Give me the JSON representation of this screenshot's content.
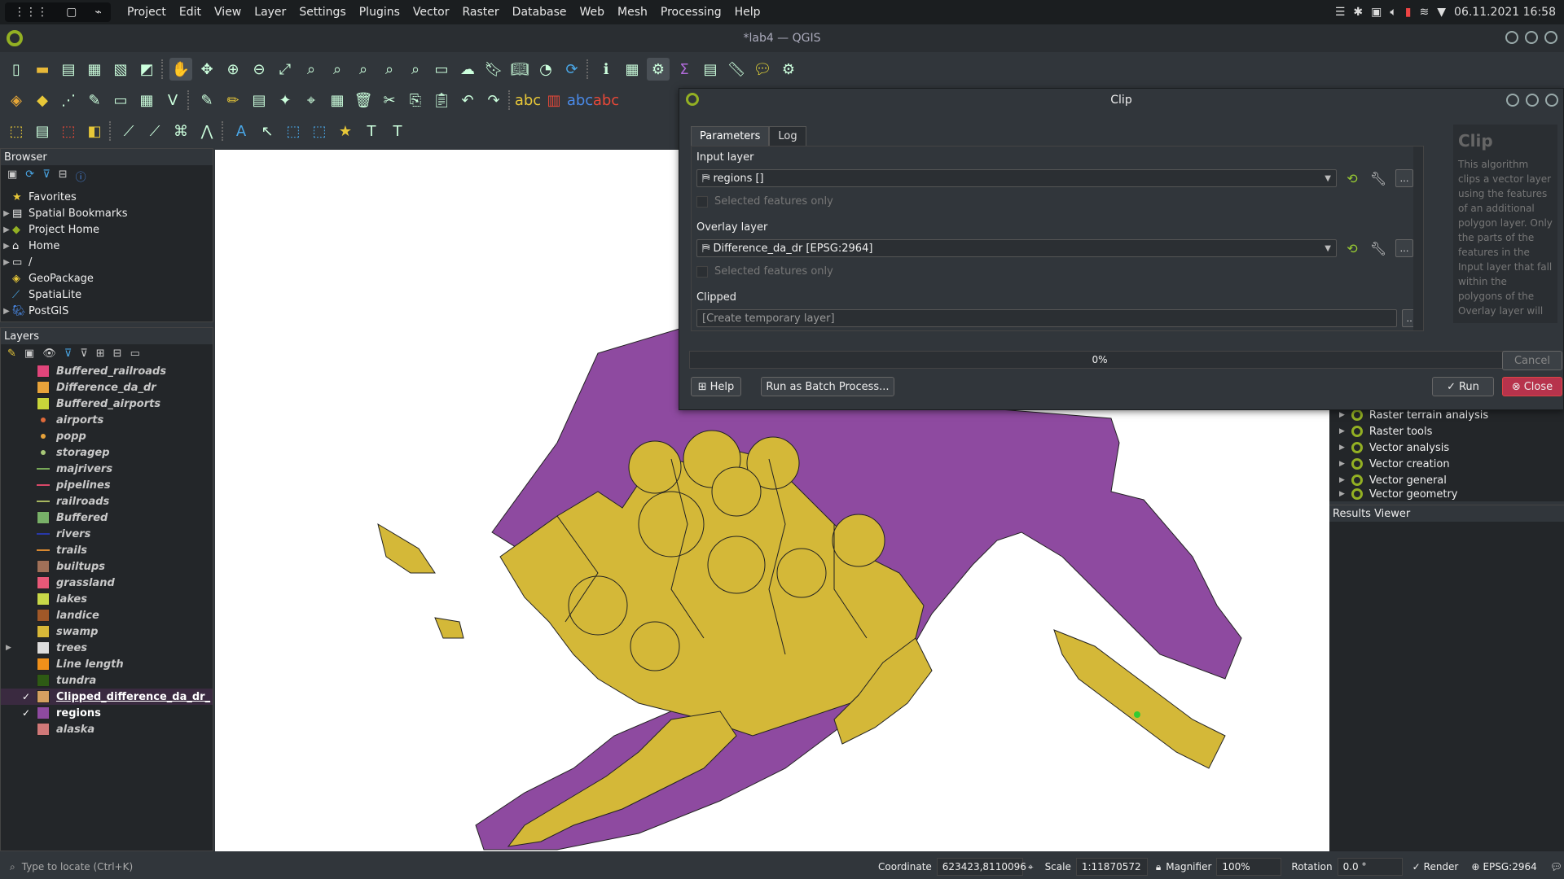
{
  "system": {
    "menu": [
      "Project",
      "Edit",
      "View",
      "Layer",
      "Settings",
      "Plugins",
      "Vector",
      "Raster",
      "Database",
      "Web",
      "Mesh",
      "Processing",
      "Help"
    ],
    "datetime": "06.11.2021 16:58"
  },
  "window": {
    "title": "*lab4 — QGIS"
  },
  "browser": {
    "title": "Browser",
    "items": [
      {
        "label": "Favorites",
        "icon": "star-icon"
      },
      {
        "label": "Spatial Bookmarks",
        "icon": "bookmark-icon"
      },
      {
        "label": "Project Home",
        "icon": "project-home-icon"
      },
      {
        "label": "Home",
        "icon": "home-folder-icon"
      },
      {
        "label": "/",
        "icon": "folder-icon"
      },
      {
        "label": "GeoPackage",
        "icon": "geopackage-icon"
      },
      {
        "label": "SpatiaLite",
        "icon": "spatialite-icon"
      },
      {
        "label": "PostGIS",
        "icon": "postgis-icon"
      }
    ]
  },
  "layers": {
    "title": "Layers",
    "items": [
      {
        "label": "Buffered_railroads",
        "color": "#e0457b",
        "kind": "fill"
      },
      {
        "label": "Difference_da_dr",
        "color": "#e8a33a",
        "kind": "fill"
      },
      {
        "label": "Buffered_airports",
        "color": "#c8d53a",
        "kind": "fill"
      },
      {
        "label": "airports",
        "color": "#e06a3a",
        "kind": "dot"
      },
      {
        "label": "popp",
        "color": "#e8a33a",
        "kind": "dot"
      },
      {
        "label": "storagep",
        "color": "#a8c878",
        "kind": "dot"
      },
      {
        "label": "majrivers",
        "color": "#78a858",
        "kind": "line"
      },
      {
        "label": "pipelines",
        "color": "#d84868",
        "kind": "line"
      },
      {
        "label": "railroads",
        "color": "#a8b860",
        "kind": "line"
      },
      {
        "label": "Buffered",
        "color": "#78b068",
        "kind": "fill"
      },
      {
        "label": "rivers",
        "color": "#2838a8",
        "kind": "line"
      },
      {
        "label": "trails",
        "color": "#d88830",
        "kind": "line"
      },
      {
        "label": "builtups",
        "color": "#a07058",
        "kind": "fill"
      },
      {
        "label": "grassland",
        "color": "#e85878",
        "kind": "fill"
      },
      {
        "label": "lakes",
        "color": "#c8d848",
        "kind": "fill"
      },
      {
        "label": "landice",
        "color": "#a05828",
        "kind": "fill"
      },
      {
        "label": "swamp",
        "color": "#d8b838",
        "kind": "fill"
      },
      {
        "label": "trees",
        "color": "#dddddd",
        "kind": "group"
      },
      {
        "label": "Line length",
        "color": "#f0901a",
        "kind": "fill"
      },
      {
        "label": "tundra",
        "color": "#2e5a14",
        "kind": "fill"
      },
      {
        "label": "Clipped_difference_da_dr_",
        "color": "#d4a060",
        "kind": "fill",
        "checked": true,
        "active": true
      },
      {
        "label": "regions",
        "color": "#8e4aa0",
        "kind": "fill",
        "checked": true,
        "active": true
      },
      {
        "label": "alaska",
        "color": "#d07878",
        "kind": "fill"
      }
    ]
  },
  "dialog": {
    "title": "Clip",
    "tabs": [
      "Parameters",
      "Log"
    ],
    "input_label": "Input layer",
    "input_value": "regions []",
    "selected_only": "Selected features only",
    "overlay_label": "Overlay layer",
    "overlay_value": "Difference_da_dr [EPSG:2964]",
    "clipped_label": "Clipped",
    "clipped_value": "[Create temporary layer]",
    "progress": "0%",
    "buttons": {
      "help": "Help",
      "batch": "Run as Batch Process...",
      "run": "Run",
      "close": "Close",
      "cancel": "Cancel"
    },
    "help_title": "Clip",
    "help_text": "This algorithm clips a vector layer using the features of an additional polygon layer. Only the parts of the features in the Input layer that fall within the polygons of the Overlay layer will"
  },
  "processing": {
    "items": [
      "Raster terrain analysis",
      "Raster tools",
      "Vector analysis",
      "Vector creation",
      "Vector general",
      "Vector geometry"
    ]
  },
  "results": {
    "title": "Results Viewer"
  },
  "statusbar": {
    "locator_placeholder": "Type to locate (Ctrl+K)",
    "coordinate_label": "Coordinate",
    "coordinate_value": "623423,8110096",
    "scale_label": "Scale",
    "scale_value": "1:11870572",
    "magnifier_label": "Magnifier",
    "magnifier_value": "100%",
    "rotation_label": "Rotation",
    "rotation_value": "0.0 °",
    "render_label": "Render",
    "crs": "EPSG:2964"
  }
}
